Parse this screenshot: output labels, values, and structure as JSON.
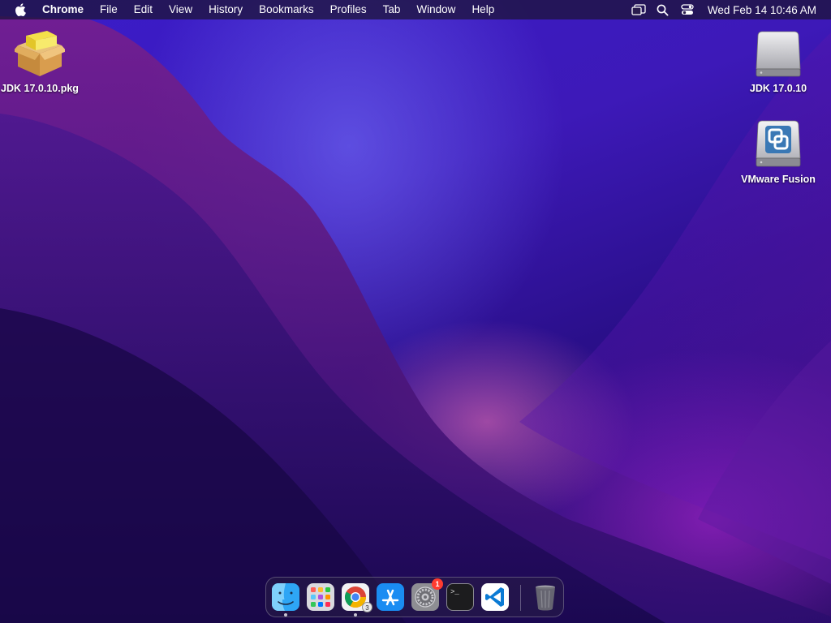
{
  "menubar": {
    "app_name": "Chrome",
    "menus": [
      "File",
      "Edit",
      "View",
      "History",
      "Bookmarks",
      "Profiles",
      "Tab",
      "Window",
      "Help"
    ],
    "clock": "Wed Feb 14  10:46 AM"
  },
  "desktop": {
    "icons": [
      {
        "label": "JDK 17.0.10.pkg",
        "icon": "package-icon"
      },
      {
        "label": "JDK 17.0.10",
        "icon": "disk-image-icon"
      },
      {
        "label": "VMware Fusion",
        "icon": "vmware-disk-icon"
      }
    ]
  },
  "dock": {
    "apps": [
      {
        "name": "Finder",
        "icon": "finder-icon"
      },
      {
        "name": "Launchpad",
        "icon": "launchpad-icon"
      },
      {
        "name": "Google Chrome",
        "icon": "chrome-icon",
        "small_badge": "3"
      },
      {
        "name": "App Store",
        "icon": "app-store-icon"
      },
      {
        "name": "System Settings",
        "icon": "system-settings-icon",
        "badge": "1"
      },
      {
        "name": "Terminal",
        "icon": "terminal-icon",
        "glyph": ">_"
      },
      {
        "name": "Visual Studio Code",
        "icon": "vscode-icon"
      },
      {
        "name": "Trash",
        "icon": "trash-icon"
      }
    ]
  },
  "colors": {
    "menubar_bg": "#1e143c",
    "badge": "#ff3b30",
    "vscode_blue": "#0a7ad4"
  }
}
